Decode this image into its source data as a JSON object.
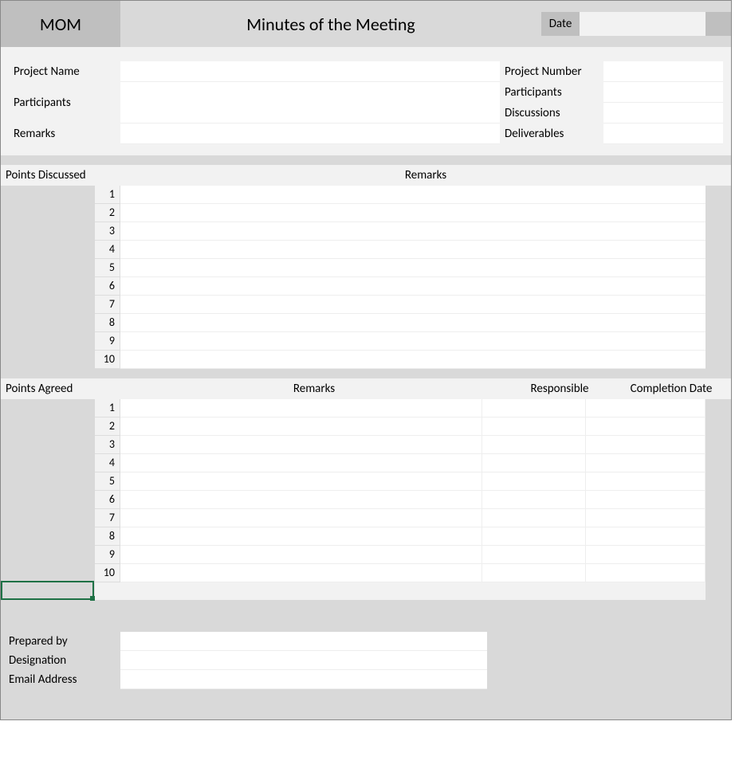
{
  "header": {
    "mom": "MOM",
    "title": "Minutes of the Meeting",
    "date_label": "Date",
    "date_value": ""
  },
  "info": {
    "labels": {
      "project_name": "Project Name",
      "participants": "Participants",
      "remarks": "Remarks",
      "project_number": "Project Number",
      "participants_count": "Participants",
      "discussions": "Discussions",
      "deliverables": "Deliverables"
    },
    "values": {
      "project_name": "",
      "participants": "",
      "remarks": "",
      "project_number": "",
      "participants_count": "",
      "discussions": "",
      "deliverables": ""
    }
  },
  "points_discussed": {
    "header_label": "Points Discussed",
    "remarks_label": "Remarks",
    "rows": [
      {
        "num": "1",
        "remark": ""
      },
      {
        "num": "2",
        "remark": ""
      },
      {
        "num": "3",
        "remark": ""
      },
      {
        "num": "4",
        "remark": ""
      },
      {
        "num": "5",
        "remark": ""
      },
      {
        "num": "6",
        "remark": ""
      },
      {
        "num": "7",
        "remark": ""
      },
      {
        "num": "8",
        "remark": ""
      },
      {
        "num": "9",
        "remark": ""
      },
      {
        "num": "10",
        "remark": ""
      }
    ]
  },
  "points_agreed": {
    "header_label": "Points Agreed",
    "remarks_label": "Remarks",
    "responsible_label": "Responsible",
    "completion_label": "Completion Date",
    "rows": [
      {
        "num": "1",
        "remark": "",
        "responsible": "",
        "completion": ""
      },
      {
        "num": "2",
        "remark": "",
        "responsible": "",
        "completion": ""
      },
      {
        "num": "3",
        "remark": "",
        "responsible": "",
        "completion": ""
      },
      {
        "num": "4",
        "remark": "",
        "responsible": "",
        "completion": ""
      },
      {
        "num": "5",
        "remark": "",
        "responsible": "",
        "completion": ""
      },
      {
        "num": "6",
        "remark": "",
        "responsible": "",
        "completion": ""
      },
      {
        "num": "7",
        "remark": "",
        "responsible": "",
        "completion": ""
      },
      {
        "num": "8",
        "remark": "",
        "responsible": "",
        "completion": ""
      },
      {
        "num": "9",
        "remark": "",
        "responsible": "",
        "completion": ""
      },
      {
        "num": "10",
        "remark": "",
        "responsible": "",
        "completion": ""
      }
    ]
  },
  "footer": {
    "labels": {
      "prepared_by": "Prepared by",
      "designation": "Designation",
      "email": "Email Address"
    },
    "values": {
      "prepared_by": "",
      "designation": "",
      "email": ""
    }
  }
}
